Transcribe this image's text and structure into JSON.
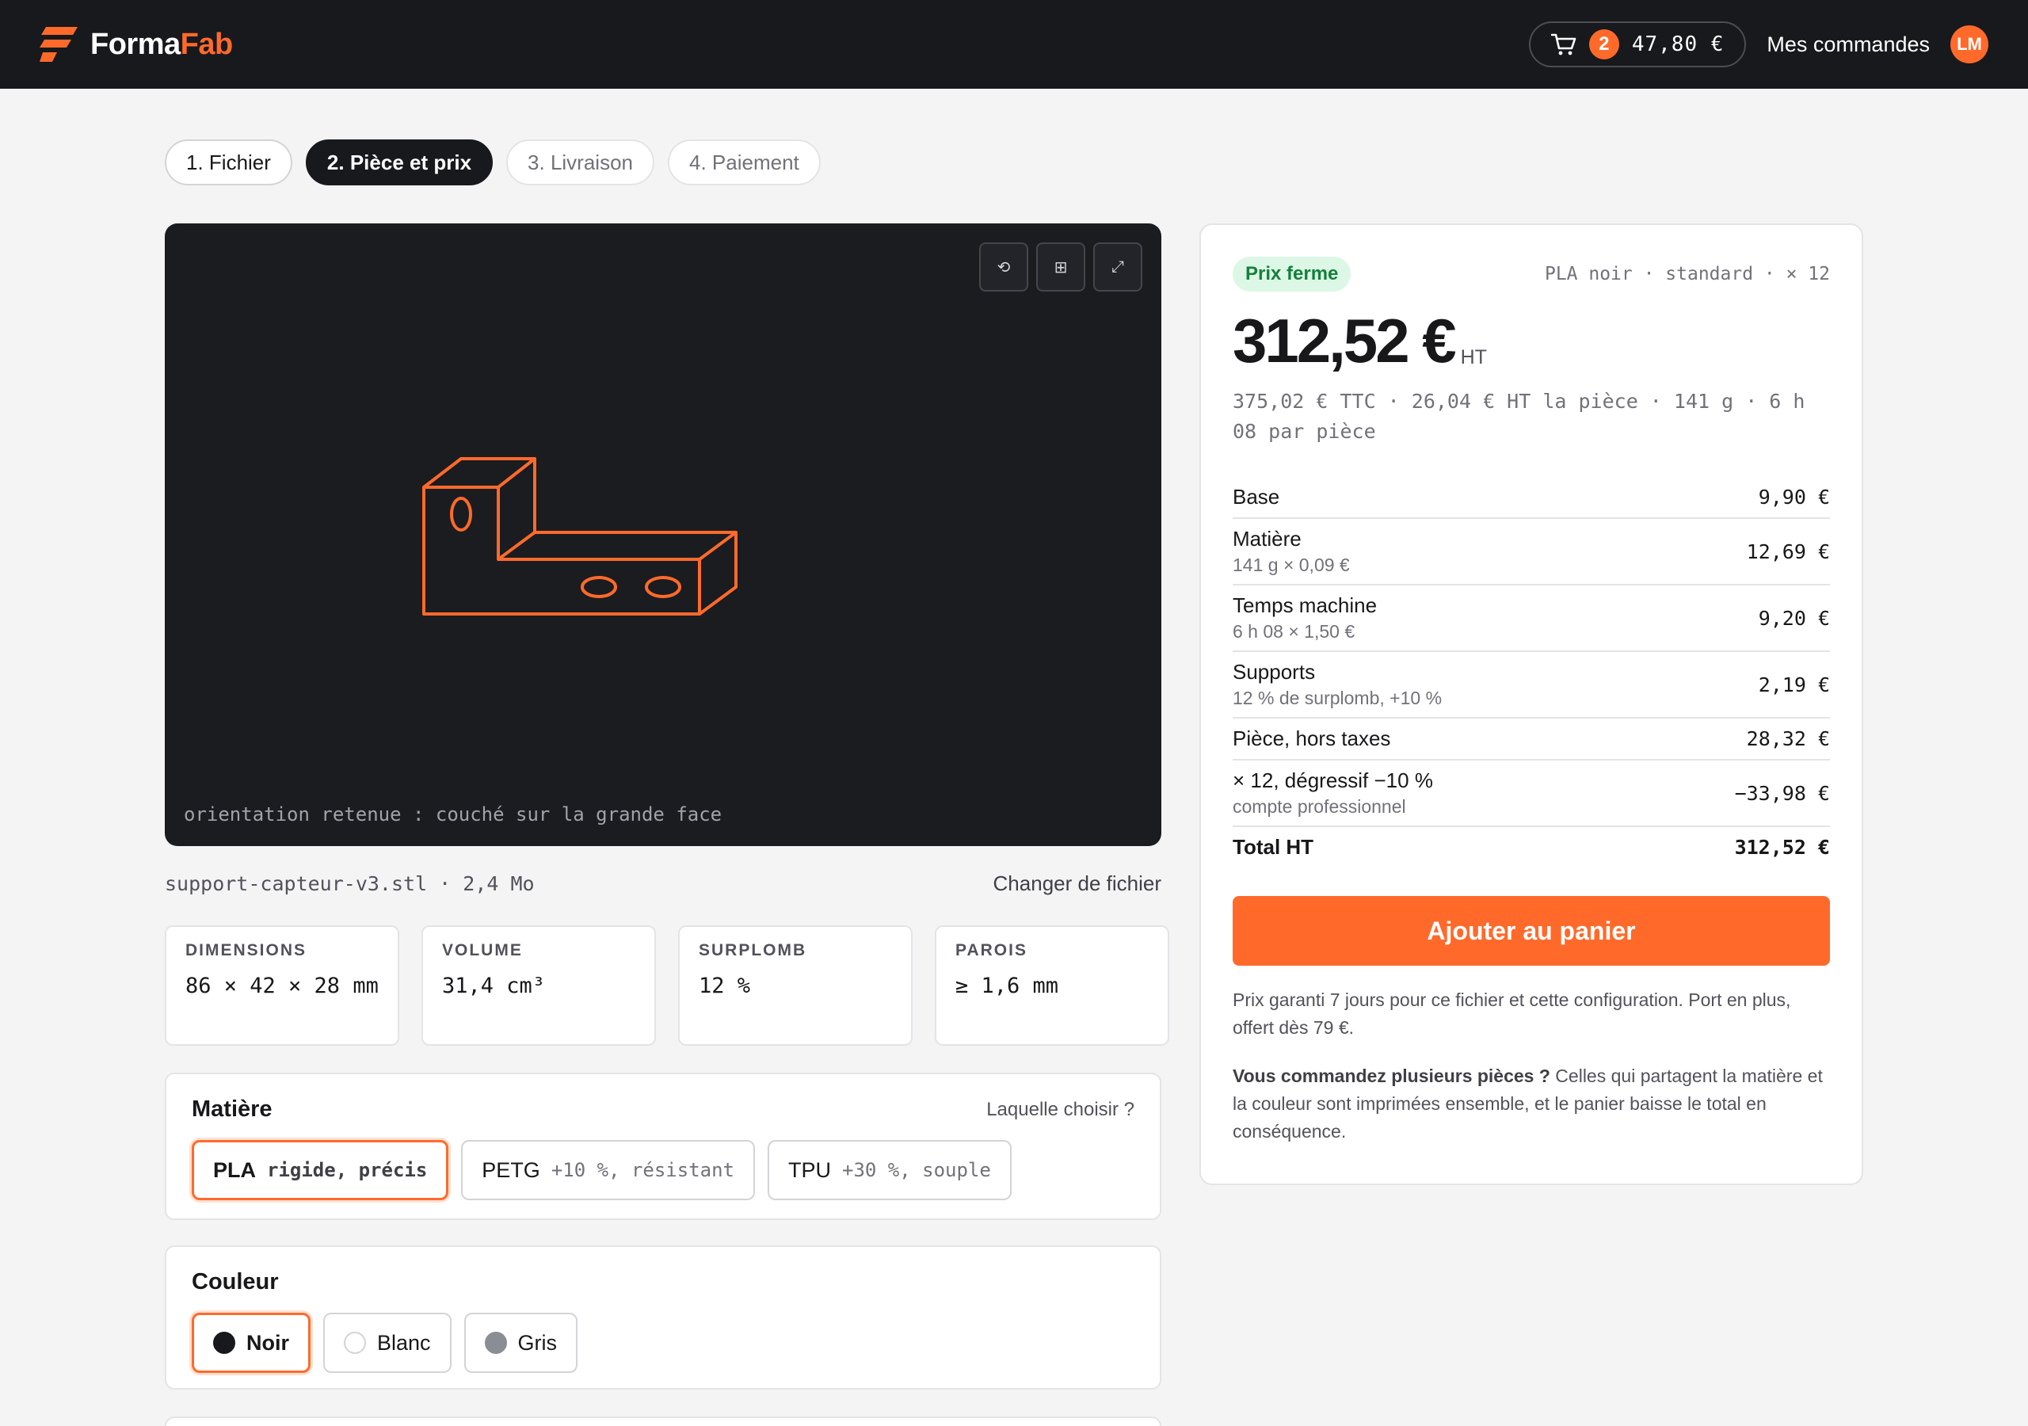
{
  "header": {
    "brand_first": "Forma",
    "brand_second": "Fab",
    "cart_count": "2",
    "cart_total": "47,80 €",
    "orders_label": "Mes commandes",
    "avatar_initials": "LM",
    "accent_color": "#ff6a2b"
  },
  "steps": [
    {
      "label": "1. Fichier",
      "state": "done"
    },
    {
      "label": "2. Pièce et prix",
      "state": "active"
    },
    {
      "label": "3. Livraison",
      "state": "todo"
    },
    {
      "label": "4. Paiement",
      "state": "todo"
    }
  ],
  "viewer": {
    "tools": [
      "rotate-icon",
      "grid-icon",
      "expand-icon"
    ],
    "caption": "orientation retenue : couché sur la grande face"
  },
  "file": {
    "name": "support-capteur-v3.stl · 2,4 Mo",
    "change_label": "Changer de fichier"
  },
  "stats": [
    {
      "label": "DIMENSIONS",
      "value": "86 × 42 × 28 mm"
    },
    {
      "label": "VOLUME",
      "value": "31,4 cm³"
    },
    {
      "label": "SURPLOMB",
      "value": "12 %"
    },
    {
      "label": "PAROIS",
      "value": "≥ 1,6 mm"
    }
  ],
  "material": {
    "title": "Matière",
    "help_link": "Laquelle choisir ?",
    "options": [
      {
        "name": "PLA",
        "sub": "rigide, précis",
        "selected": true
      },
      {
        "name": "PETG",
        "sub": "+10 %, résistant",
        "selected": false
      },
      {
        "name": "TPU",
        "sub": "+30 %, souple",
        "selected": false
      }
    ]
  },
  "color": {
    "title": "Couleur",
    "options": [
      {
        "name": "Noir",
        "swatch": "#18191c",
        "selected": true
      },
      {
        "name": "Blanc",
        "swatch": "#ffffff",
        "selected": false
      },
      {
        "name": "Gris",
        "swatch": "#8b8d94",
        "selected": false
      }
    ]
  },
  "price": {
    "badge": "Prix ferme",
    "config_summary": "PLA noir · standard · × 12",
    "amount": "312,52 €",
    "suffix": "HT",
    "detail": "375,02 € TTC · 26,04 € HT la pièce · 141 g · 6 h 08 par pièce",
    "breakdown": [
      {
        "label": "Base",
        "sub": "",
        "value": "9,90 €"
      },
      {
        "label": "Matière",
        "sub": "141 g × 0,09 €",
        "value": "12,69 €"
      },
      {
        "label": "Temps machine",
        "sub": "6 h 08 × 1,50 €",
        "value": "9,20 €"
      },
      {
        "label": "Supports",
        "sub": "12 % de surplomb, +10 %",
        "value": "2,19 €"
      },
      {
        "label": "Pièce, hors taxes",
        "sub": "",
        "value": "28,32 €"
      },
      {
        "label": "× 12, dégressif −10 %",
        "sub": "compte professionnel",
        "value": "−33,98 €"
      },
      {
        "label": "Total HT",
        "sub": "",
        "value": "312,52 €"
      }
    ],
    "cta": "Ajouter au panier",
    "note": "Prix garanti 7 jours pour ce fichier et cette configuration. Port en plus, offert dès 79 €.",
    "note2_bold": "Vous commandez plusieurs pièces ?",
    "note2": " Celles qui partagent la matière et la couleur sont imprimées ensemble, et le panier baisse le total en conséquence."
  }
}
